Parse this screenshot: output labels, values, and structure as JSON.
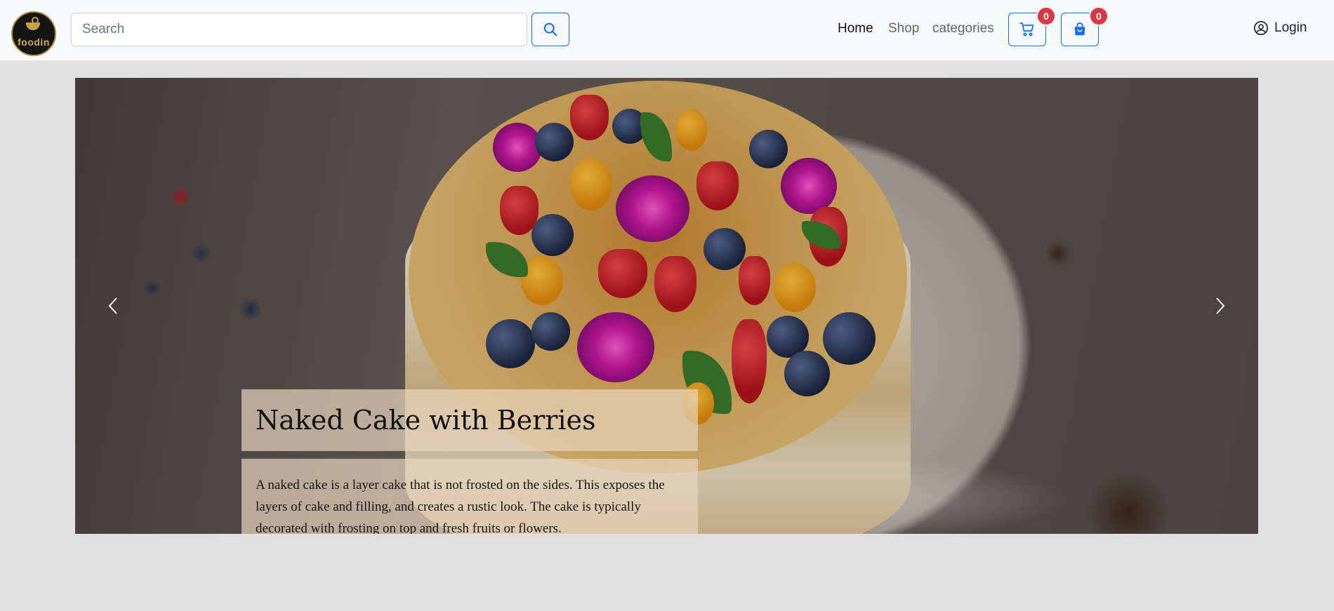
{
  "brand": {
    "logo_text": "foodin"
  },
  "search": {
    "placeholder": "Search"
  },
  "nav": {
    "links": [
      {
        "label": "Home",
        "active": true
      },
      {
        "label": "Shop",
        "active": false
      },
      {
        "label": "categories",
        "active": false
      }
    ]
  },
  "cart": {
    "count": "0"
  },
  "orders": {
    "count": "0"
  },
  "login": {
    "label": "Login"
  },
  "carousel": {
    "title": "Naked Cake with Berries",
    "description": "A naked cake is a layer cake that is not frosted on the sides. This exposes the layers of cake and filling, and creates a rustic look. The cake is typically decorated with frosting on top and fresh fruits or flowers.",
    "slide_count": 6,
    "active_slide": 6
  },
  "colors": {
    "primary": "#0d6efd",
    "badge": "#dc3545",
    "navbar_bg": "#f8f9fa",
    "page_bg": "#e0e0e0",
    "caption_bg": "rgba(232,212,190,0.7)"
  },
  "icons": {
    "search": "search-icon",
    "cart": "cart-icon",
    "orders": "shopping-bag-icon",
    "login": "user-circle-icon",
    "prev": "chevron-left-icon",
    "next": "chevron-right-icon"
  }
}
